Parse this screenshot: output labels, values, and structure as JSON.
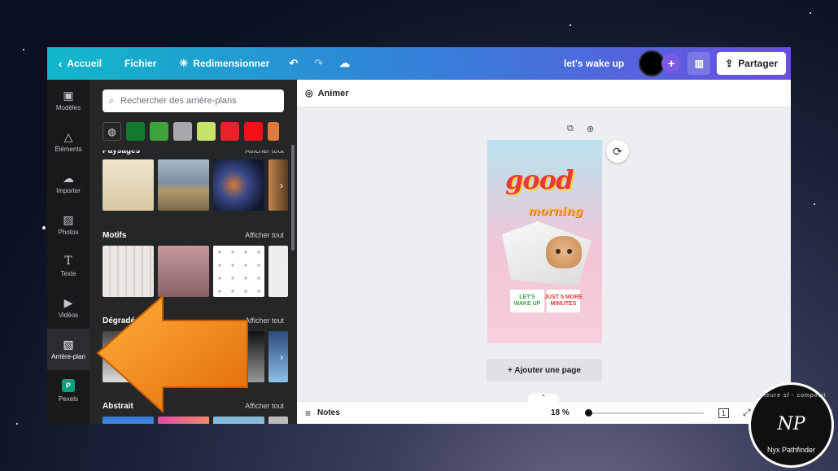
{
  "topbar": {
    "home_label": "Accueil",
    "file_label": "Fichier",
    "resize_label": "Redimensionner",
    "project_name": "let's wake up",
    "share_label": "Partager"
  },
  "rail": {
    "items": [
      {
        "label": "Modèles",
        "icon": "layout-icon"
      },
      {
        "label": "Éléments",
        "icon": "shapes-icon"
      },
      {
        "label": "Importer",
        "icon": "cloud-upload-icon"
      },
      {
        "label": "Photos",
        "icon": "image-icon"
      },
      {
        "label": "Texte",
        "icon": "text-icon"
      },
      {
        "label": "Vidéos",
        "icon": "video-icon"
      },
      {
        "label": "Arrière-plan",
        "icon": "hatch-icon"
      },
      {
        "label": "Pexels",
        "icon": "pexels-icon"
      }
    ]
  },
  "panel": {
    "search_placeholder": "Rechercher des arrière-plans",
    "swatches": [
      "#137a2d",
      "#3da33a",
      "#a6a8ab",
      "#c7e26a",
      "#e8222b",
      "#f3121a",
      "#e07a3c"
    ],
    "sections": [
      {
        "title": "Paysages",
        "see_all": "Afficher tout"
      },
      {
        "title": "Motifs",
        "see_all": "Afficher tout"
      },
      {
        "title": "Dégradés",
        "see_all": "Afficher tout"
      },
      {
        "title": "Abstrait",
        "see_all": "Afficher tout"
      }
    ]
  },
  "subbar": {
    "animate_label": "Animer"
  },
  "design": {
    "word1": "good",
    "word2": "morning",
    "box1": "LET'S\nWAKE UP",
    "box2": "JUST 5 MORE\nMINUTES",
    "colors": {
      "red": "#e83a3a",
      "yellow": "#f5d33a",
      "green": "#3aa54a"
    }
  },
  "canvas": {
    "add_page_label": "+ Ajouter une page"
  },
  "bottombar": {
    "notes_label": "Notes",
    "zoom": "18 %",
    "page_count": "1"
  },
  "watermark": {
    "name": "Nyx Pathfinder",
    "ring_text": "auteure sf - composit",
    "monogram": "NP"
  }
}
